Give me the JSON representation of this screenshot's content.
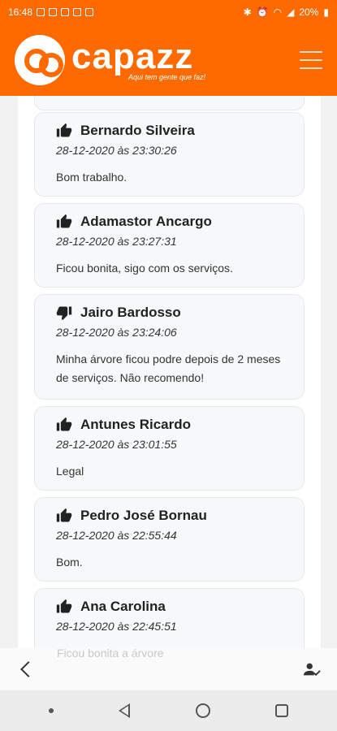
{
  "status_bar": {
    "time": "16:48",
    "battery": "20%"
  },
  "header": {
    "logo_text": "capazz",
    "tagline": "Aqui tem gente que faz!"
  },
  "reviews": [
    {
      "name": "Bernardo Silveira",
      "date": "28-12-2020 às 23:30:26",
      "text": "Bom trabalho.",
      "rating": "thumbs-up-icon"
    },
    {
      "name": "Adamastor Ancargo",
      "date": "28-12-2020 às 23:27:31",
      "text": "Ficou bonita, sigo com os serviços.",
      "rating": "thumbs-up-icon"
    },
    {
      "name": "Jairo Bardosso",
      "date": "28-12-2020 às 23:24:06",
      "text": "Minha árvore ficou podre depois de 2 meses de serviços. Não recomendo!",
      "rating": "thumbs-down-icon"
    },
    {
      "name": "Antunes Ricardo",
      "date": "28-12-2020 às 23:01:55",
      "text": "Legal",
      "rating": "thumbs-up-icon"
    },
    {
      "name": "Pedro José Bornau",
      "date": "28-12-2020 às 22:55:44",
      "text": "Bom.",
      "rating": "thumbs-up-icon"
    },
    {
      "name": "Ana Carolina",
      "date": "28-12-2020 às 22:45:51",
      "text": "Ficou bonita a árvore",
      "rating": "thumbs-up-icon"
    }
  ],
  "colors": {
    "brand": "#ff6a00",
    "card_bg": "#f7f8fa"
  }
}
